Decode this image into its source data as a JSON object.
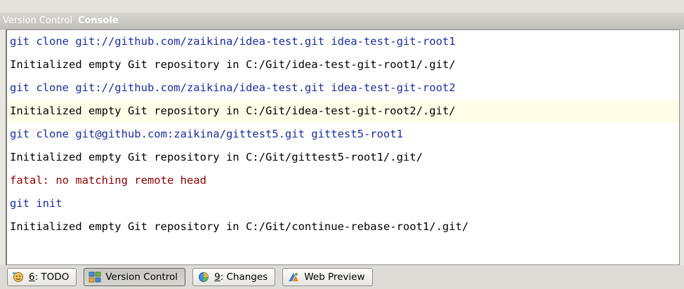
{
  "titlebar": {
    "tab_inactive": "Version Control",
    "tab_active": "Console"
  },
  "console": {
    "lines": [
      {
        "text": "git clone git://github.com/zaikina/idea-test.git idea-test-git-root1",
        "type": "command"
      },
      {
        "text": "Initialized empty Git repository in C:/Git/idea-test-git-root1/.git/",
        "type": "output"
      },
      {
        "text": "git clone git://github.com/zaikina/idea-test.git idea-test-git-root2",
        "type": "command"
      },
      {
        "text": "Initialized empty Git repository in C:/Git/idea-test-git-root2/.git/",
        "type": "output",
        "highlighted": true
      },
      {
        "text": "git clone git@github.com:zaikina/gittest5.git gittest5-root1",
        "type": "command"
      },
      {
        "text": "Initialized empty Git repository in C:/Git/gittest5-root1/.git/",
        "type": "output"
      },
      {
        "text": "fatal: no matching remote head",
        "type": "error"
      },
      {
        "text": "git init",
        "type": "command"
      },
      {
        "text": "Initialized empty Git repository in C:/Git/continue-rebase-root1/.git/",
        "type": "output"
      }
    ]
  },
  "toolbar": {
    "todo": {
      "num": "6",
      "rest": ": TODO",
      "icon": "todo-icon"
    },
    "version_control": {
      "label": "Version Control",
      "icon": "version-control-icon"
    },
    "changes": {
      "num": "9",
      "rest": ": Changes",
      "icon": "changes-icon"
    },
    "web_preview": {
      "label": "Web Preview",
      "icon": "web-preview-icon"
    }
  },
  "colors": {
    "command": "#1a2d9c",
    "output": "#000000",
    "error": "#8b0000",
    "highlight": "#fffde8"
  }
}
